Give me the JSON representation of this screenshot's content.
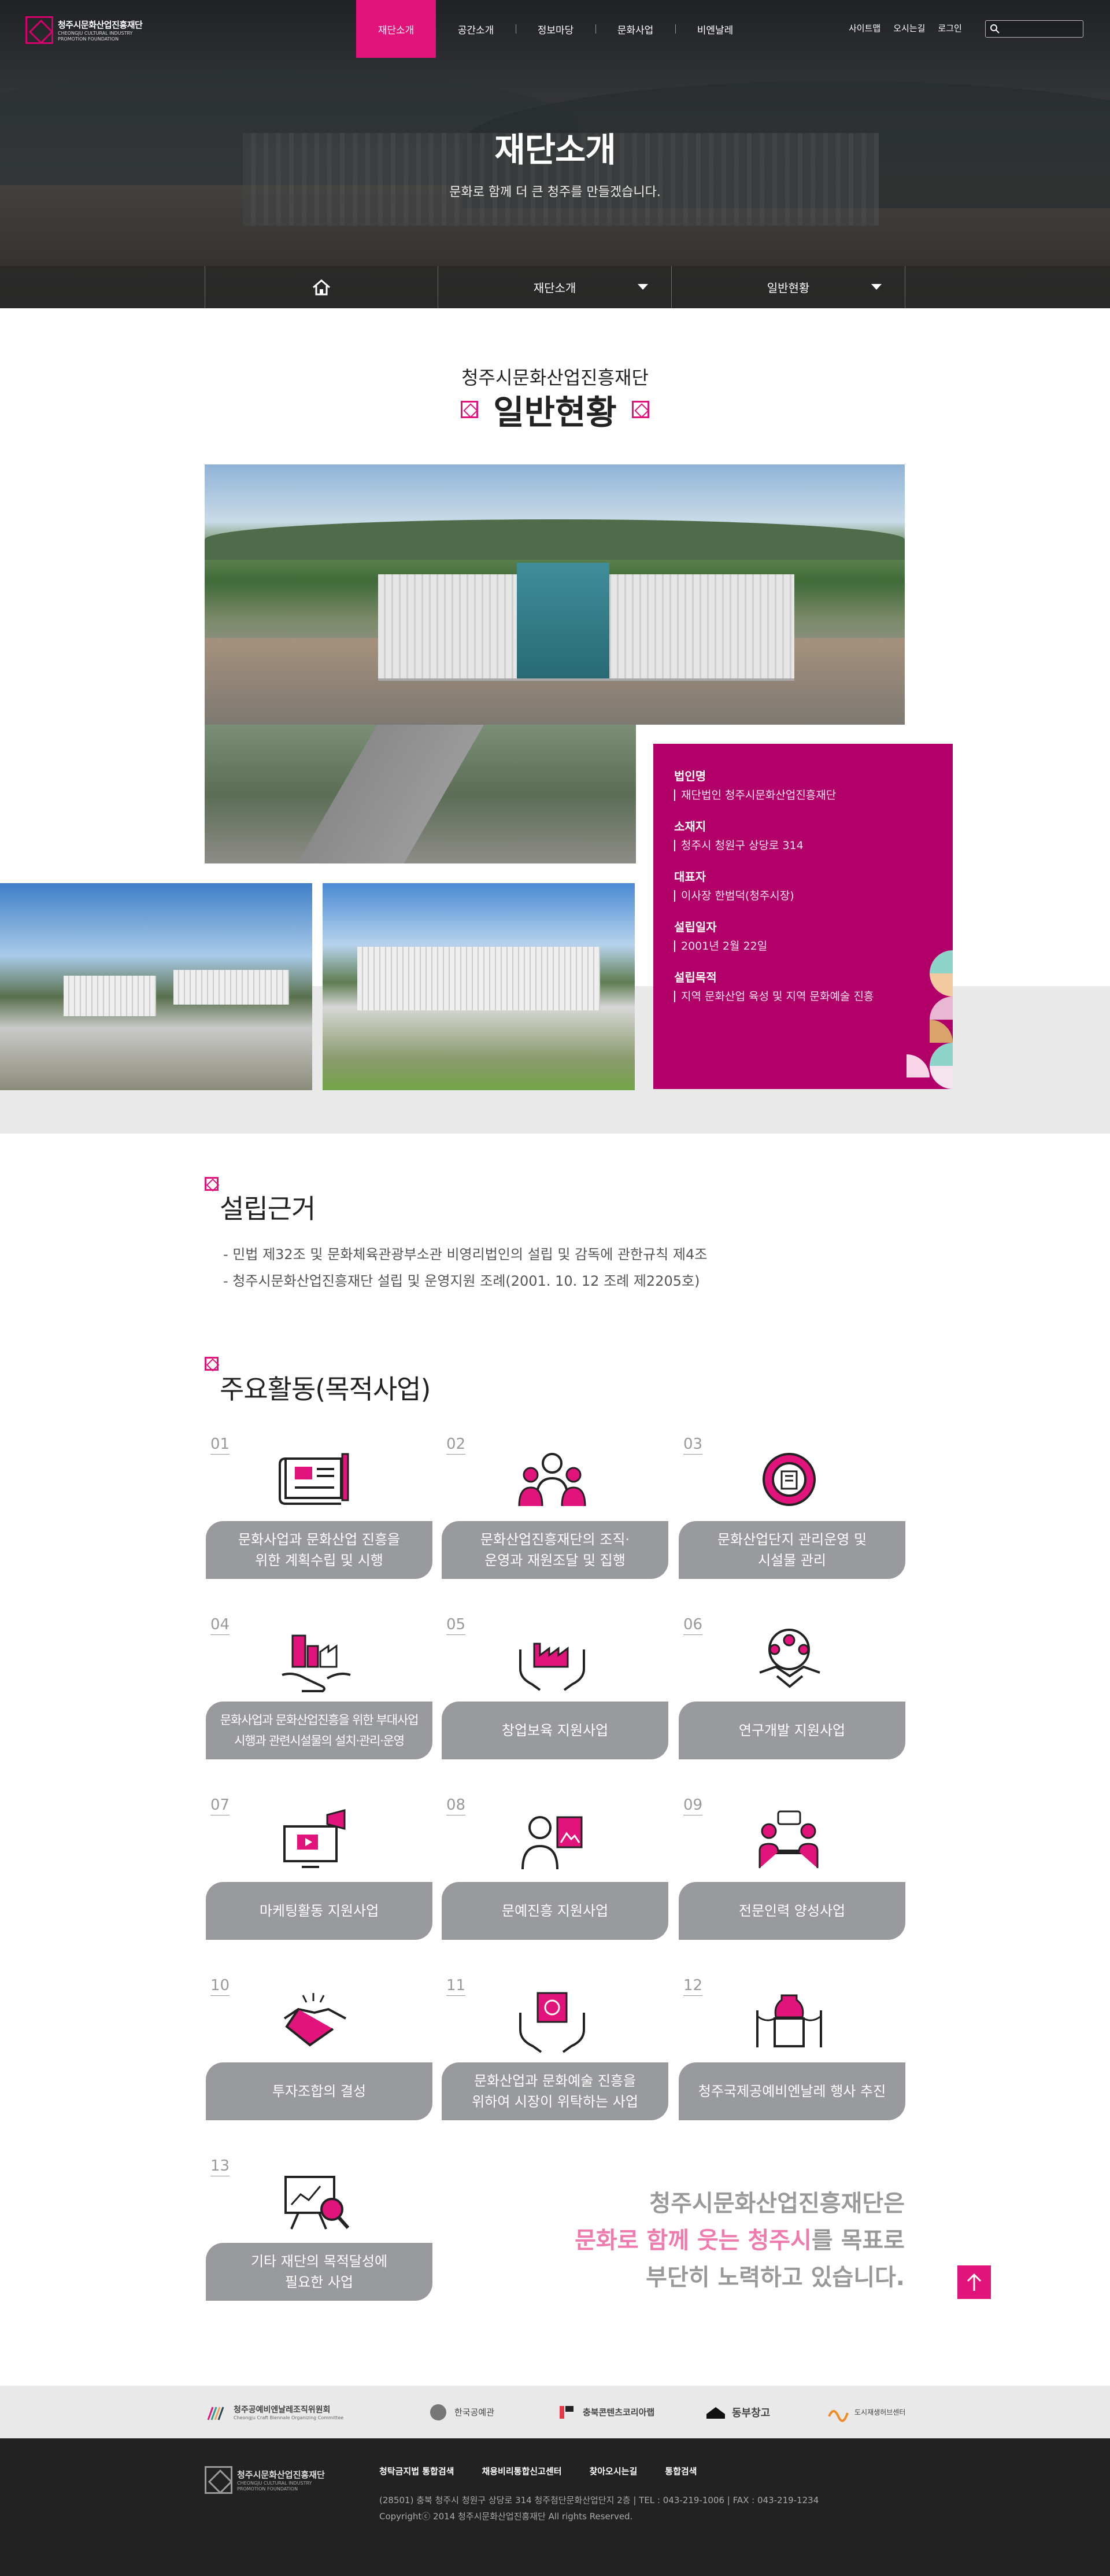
{
  "header": {
    "logo_ko": "청주시문화산업진흥재단",
    "logo_en": "CHEONGJU CULTURAL INDUSTRY PROMOTION FOUNDATION",
    "nav": [
      "재단소개",
      "공간소개",
      "정보마당",
      "문화사업",
      "비엔날레"
    ],
    "util": [
      "사이트맵",
      "오시는길",
      "로그인"
    ],
    "search_placeholder": ""
  },
  "hero": {
    "title": "재단소개",
    "subtitle": "문화로 함께 더 큰 청주를 만들겠습니다."
  },
  "location": {
    "menu1": "재단소개",
    "menu2": "일반현황"
  },
  "overview": {
    "subtitle": "청주시문화산업진흥재단",
    "title": "일반현황",
    "info": [
      {
        "label": "법인명",
        "value": "재단법인 청주시문화산업진흥재단"
      },
      {
        "label": "소재지",
        "value": "청주시 청원구 상당로 314"
      },
      {
        "label": "대표자",
        "value": "이사장 한범덕(청주시장)"
      },
      {
        "label": "설립일자",
        "value": "2001년 2월 22일"
      },
      {
        "label": "설립목적",
        "value": "지역 문화산업 육성 및 지역 문화예술 진흥"
      }
    ]
  },
  "basis": {
    "title": "설립근거",
    "items": [
      "- 민법 제32조 및 문화체육관광부소관 비영리법인의 설립 및 감독에 관한규칙 제4조",
      "- 청주시문화산업진흥재단 설립 및 운영지원 조례(2001. 10. 12 조례 제2205호)"
    ]
  },
  "activities": {
    "title": "주요활동(목적사업)",
    "items": [
      {
        "num": "01",
        "icon": "blueprint-plan-icon",
        "label": "문화사업과 문화산업 진흥을\n위한 계획수립 및 시행"
      },
      {
        "num": "02",
        "icon": "team-people-icon",
        "label": "문화산업진흥재단의 조직·\n운영과 재원조달 및 집행"
      },
      {
        "num": "03",
        "icon": "gear-building-icon",
        "label": "문화산업단지 관리운영 및\n시설물 관리"
      },
      {
        "num": "04",
        "icon": "city-factory-hands-icon",
        "label": "문화사업과 문화산업진흥을 위한 부대사업\n시행과 관련시설물의 설치·관리·운영"
      },
      {
        "num": "05",
        "icon": "factory-hands-icon",
        "label": "창업보육 지원사업"
      },
      {
        "num": "06",
        "icon": "handshake-team-icon",
        "label": "연구개발 지원사업"
      },
      {
        "num": "07",
        "icon": "marketing-monitor-icon",
        "label": "마케팅활동 지원사업"
      },
      {
        "num": "08",
        "icon": "artist-easel-icon",
        "label": "문예진흥 지원사업"
      },
      {
        "num": "09",
        "icon": "mentoring-desk-icon",
        "label": "전문인력 양성사업"
      },
      {
        "num": "10",
        "icon": "handshake-icon",
        "label": "투자조합의 결성"
      },
      {
        "num": "11",
        "icon": "culture-art-hands-icon",
        "label": "문화산업과 문화예술 진흥을\n위하여 시장이 위탁하는 사업"
      },
      {
        "num": "12",
        "icon": "exhibition-vase-icon",
        "label": "청주국제공예비엔날레 행사 추진"
      },
      {
        "num": "13",
        "icon": "analysis-board-icon",
        "label": "기타 재단의 목적달성에\n필요한 사업"
      }
    ]
  },
  "closing": {
    "line1": "청주시문화산업진흥재단은",
    "line2_highlight": "문화로 함께 웃는 청주시",
    "line2_rest": "를 목표로",
    "line3": "부단히 노력하고 있습니다."
  },
  "partners": [
    {
      "name": "청주공예비엔날레조직위원회",
      "sub": "Cheongju Craft Biennale Organizing Committee"
    },
    {
      "name": "한국공예관",
      "sub": ""
    },
    {
      "name": "충북콘텐츠코리아랩",
      "sub": ""
    },
    {
      "name": "동부창고",
      "sub": ""
    },
    {
      "name": "도시재생허브센터",
      "sub": ""
    }
  ],
  "footer": {
    "links": [
      "청탁금지법 통합검색",
      "채용비리통합신고센터",
      "찾아오시는길",
      "통합검색"
    ],
    "address": "(28501) 충북 청주시 청원구 상당로 314 청주첨단문화산업단지 2층  |  TEL : 043-219-1006  |  FAX : 043-219-1234",
    "copyright": "Copyrightⓒ 2014 청주시문화산업진흥재단 All rights Reserved."
  },
  "colors": {
    "accent": "#e0147a",
    "info_box": "#b10068",
    "label_gray": "#999a9d",
    "footer": "#222222"
  }
}
